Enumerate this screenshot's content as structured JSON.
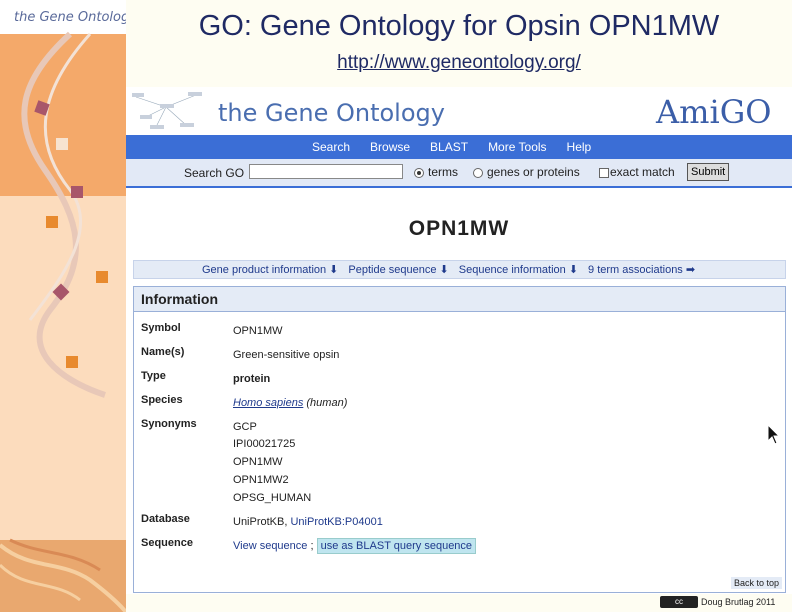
{
  "slide": {
    "title": "GO: Gene Ontology for Opsin OPN1MW",
    "url": "http://www.geneontology.org/"
  },
  "sidebar": {
    "logo_text": "the Gene Ontology"
  },
  "header": {
    "logo_text": "the Gene Ontology",
    "amigo_logo": "AmiGO"
  },
  "nav": {
    "items": [
      "Search",
      "Browse",
      "BLAST",
      "More Tools",
      "Help"
    ]
  },
  "search": {
    "label": "Search GO",
    "value": "",
    "opt_terms": "terms",
    "opt_genes": "genes or proteins",
    "opt_exact": "exact match",
    "submit_label": "Submit"
  },
  "gene": {
    "title": "OPN1MW"
  },
  "tabs": [
    "Gene product information ⬇",
    "Peptide sequence ⬇",
    "Sequence information ⬇",
    "9 term associations ➡"
  ],
  "info": {
    "header": "Information",
    "symbol_label": "Symbol",
    "symbol_value": "OPN1MW",
    "names_label": "Name(s)",
    "names_value": "Green-sensitive opsin",
    "type_label": "Type",
    "type_value": "protein",
    "species_label": "Species",
    "species_value": "Homo sapiens",
    "species_suffix": "(human)",
    "synonyms_label": "Synonyms",
    "synonyms": [
      "GCP",
      "IPI00021725",
      "OPN1MW",
      "OPN1MW2",
      "OPSG_HUMAN"
    ],
    "database_label": "Database",
    "database_prefix": "UniProtKB,",
    "database_link": "UniProtKB:P04001",
    "sequence_label": "Sequence",
    "view_seq": "View sequence",
    "seq_sep": ";",
    "blast_link": "use as BLAST query sequence",
    "back_to_top": "Back to top"
  },
  "footer": {
    "cc_icon": "cc",
    "credit": "Doug Brutlag 2011"
  }
}
